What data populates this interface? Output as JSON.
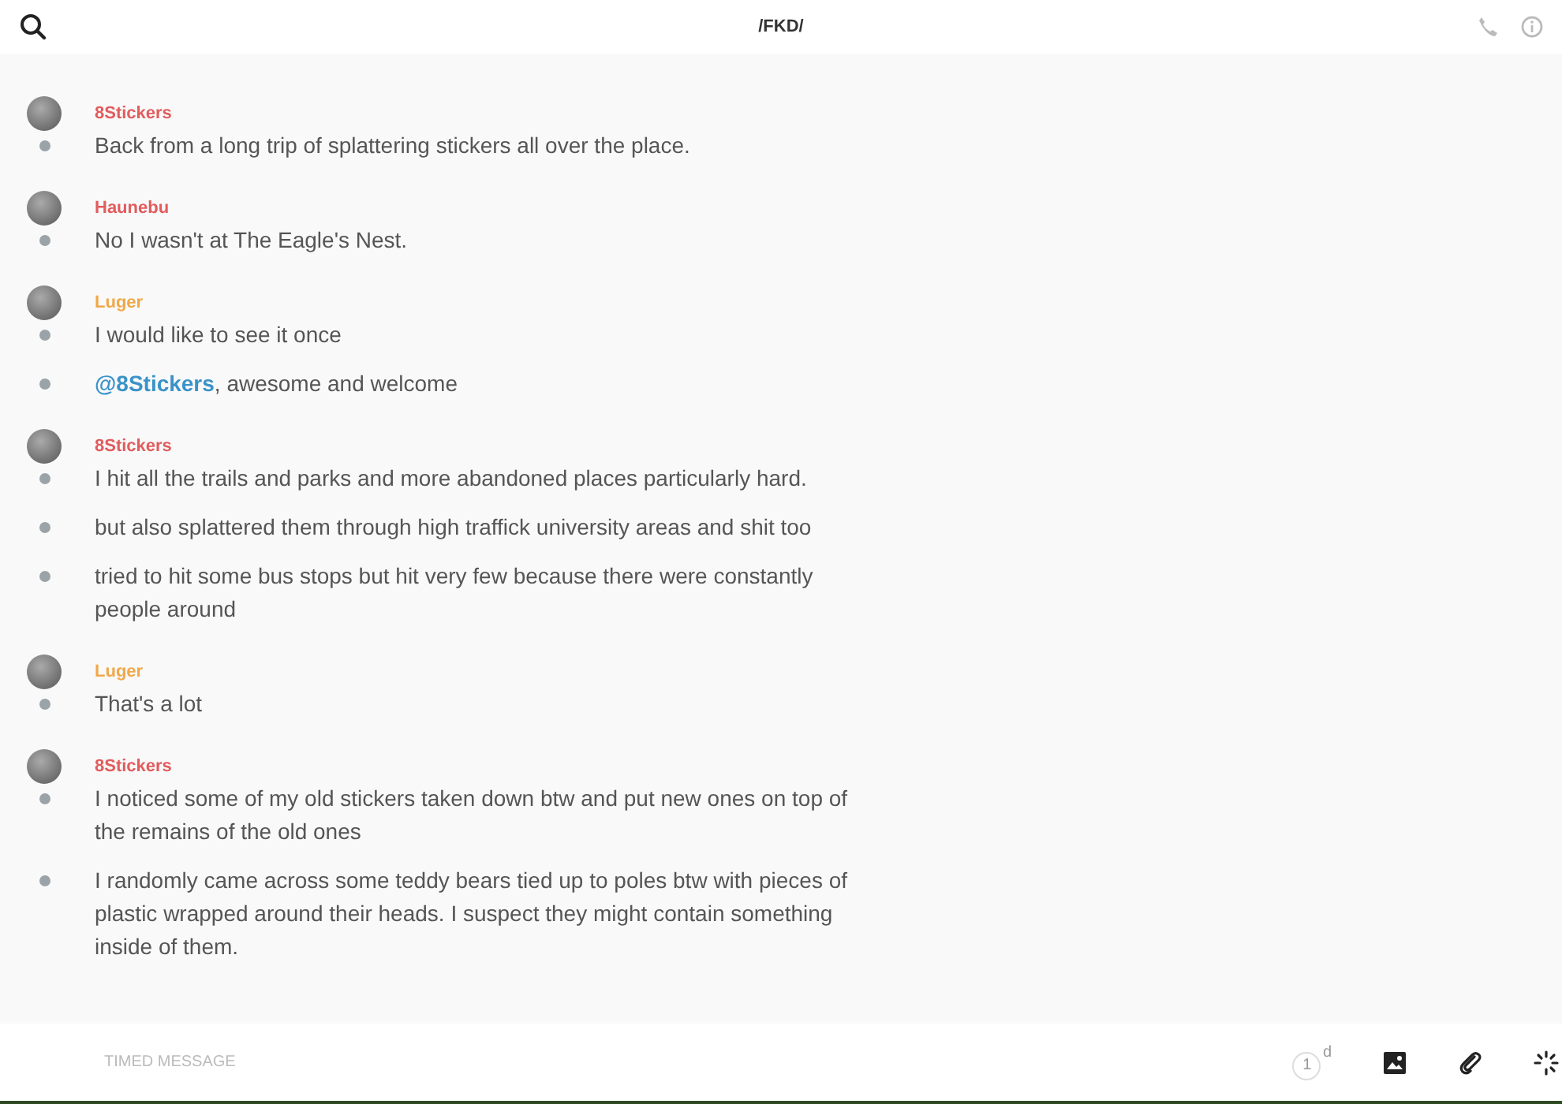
{
  "header": {
    "title": "/FKD/"
  },
  "messages": [
    {
      "author": "8Stickers",
      "color": "#e25c5c",
      "lines": [
        {
          "text": "Back from a long trip of splattering stickers all over the place."
        }
      ]
    },
    {
      "author": "Haunebu",
      "color": "#e25c5c",
      "lines": [
        {
          "text": "No I wasn't at The Eagle's Nest."
        }
      ]
    },
    {
      "author": "Luger",
      "color": "#f0a848",
      "lines": [
        {
          "text": "I would like to see it once"
        },
        {
          "mention": "@8Stickers",
          "text": ", awesome and welcome"
        }
      ]
    },
    {
      "author": "8Stickers",
      "color": "#e25c5c",
      "lines": [
        {
          "text": "I hit all the trails and parks and more abandoned places particularly hard."
        },
        {
          "text": "but also splattered them through high traffick university areas and shit too"
        },
        {
          "text": "tried to hit some bus stops but hit very few because there were constantly people around"
        }
      ]
    },
    {
      "author": "Luger",
      "color": "#f0a848",
      "lines": [
        {
          "text": "That's a lot"
        }
      ]
    },
    {
      "author": "8Stickers",
      "color": "#e25c5c",
      "lines": [
        {
          "text": "I noticed some of my old stickers taken down btw and put new ones on top of the remains of the old ones"
        },
        {
          "text": "I randomly came across some teddy bears tied up to poles btw with pieces of plastic wrapped around their heads. I suspect they might contain something inside of them."
        }
      ]
    }
  ],
  "composer": {
    "placeholder": "TIMED MESSAGE",
    "timer": {
      "value": "1",
      "unit": "d"
    }
  }
}
